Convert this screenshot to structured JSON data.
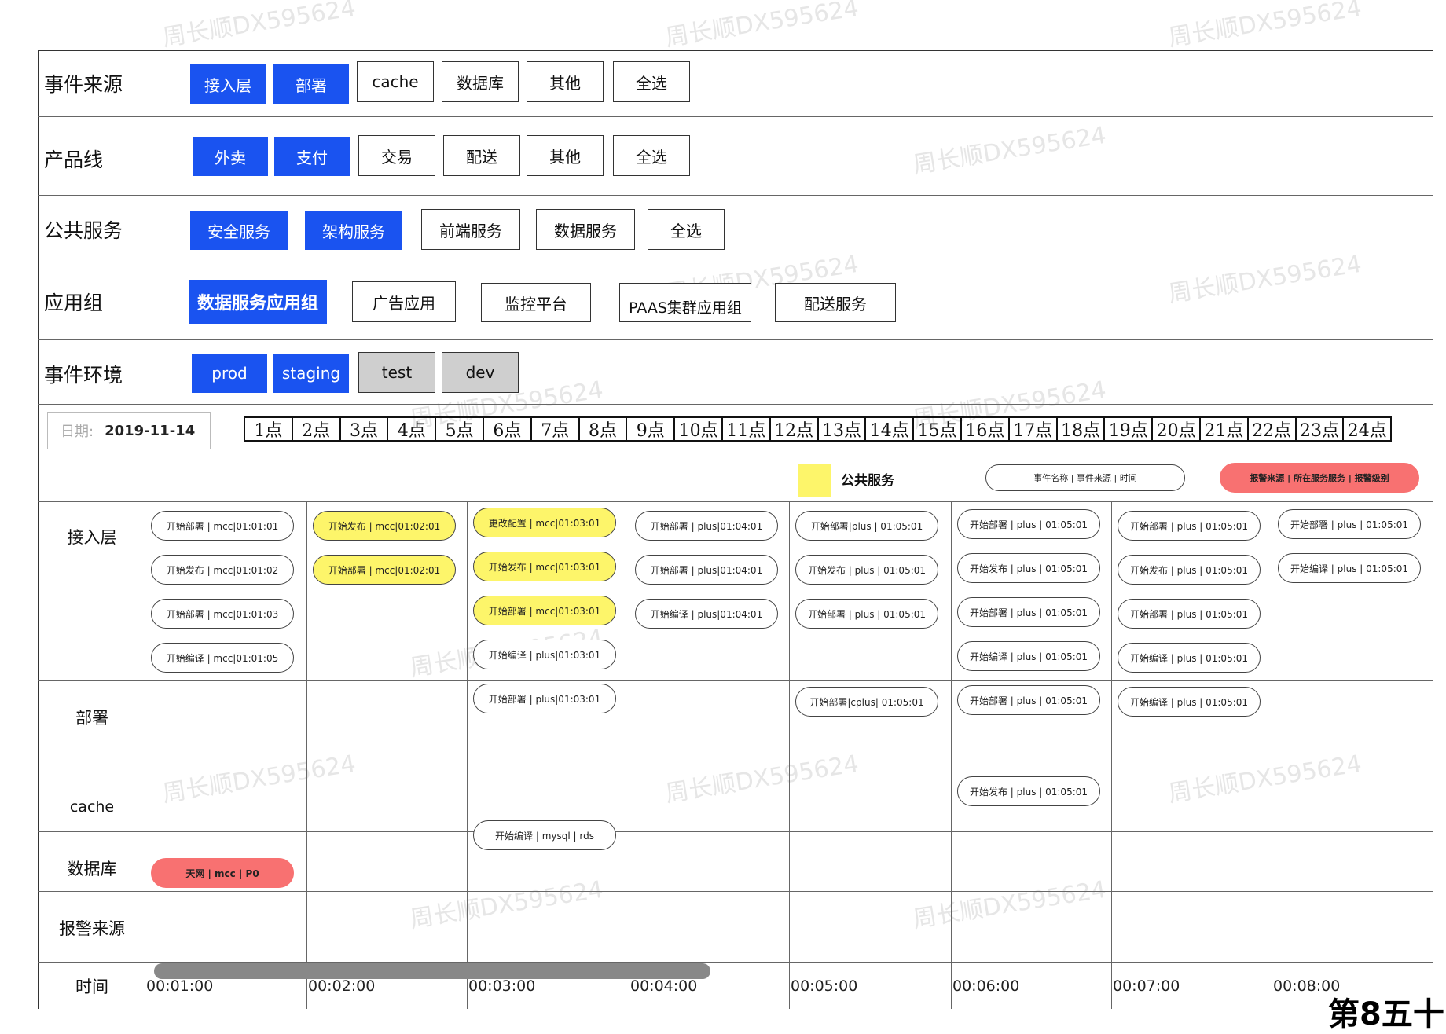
{
  "filters": {
    "event_source": {
      "label": "事件来源",
      "options": [
        "接入层",
        "部署",
        "cache",
        "数据库",
        "其他",
        "全选"
      ],
      "selected": [
        0,
        1
      ]
    },
    "product_line": {
      "label": "产品线",
      "options": [
        "外卖",
        "支付",
        "交易",
        "配送",
        "其他",
        "全选"
      ],
      "selected": [
        0,
        1
      ]
    },
    "public_service": {
      "label": "公共服务",
      "options": [
        "安全服务",
        "架构服务",
        "前端服务",
        "数据服务",
        "全选"
      ],
      "selected": [
        0,
        1
      ]
    },
    "app_group": {
      "label": "应用组",
      "options": [
        "数据服务应用组",
        "广告应用",
        "监控平台",
        "PAAS集群应用组",
        "配送服务"
      ],
      "selected": [
        0
      ]
    },
    "environment": {
      "label": "事件环境",
      "options": [
        "prod",
        "staging",
        "test",
        "dev"
      ],
      "selected": [
        0,
        1
      ],
      "gray": [
        2,
        3
      ]
    }
  },
  "date": {
    "label": "日期:",
    "value": "2019-11-14"
  },
  "hours": [
    "1点",
    "2点",
    "3点",
    "4点",
    "5点",
    "6点",
    "7点",
    "8点",
    "9点",
    "10点",
    "11点",
    "12点",
    "13点",
    "14点",
    "15点",
    "16点",
    "17点",
    "18点",
    "19点",
    "20点",
    "21点",
    "22点",
    "23点",
    "24点"
  ],
  "legend": {
    "public_service": "公共服务",
    "event_format": "事件名称 | 事件来源 | 时间",
    "alarm_format": "报警来源 | 所在服务服务 | 报警级别",
    "public_service_color": "#fdf56a",
    "alarm_color": "#f87171"
  },
  "grid": {
    "rows": [
      "接入层",
      "部署",
      "cache",
      "数据库",
      "报警来源",
      "时间"
    ],
    "times": [
      "00:01:00",
      "00:02:00",
      "00:03:00",
      "00:04:00",
      "00:05:00",
      "00:06:00",
      "00:07:00",
      "00:08:00"
    ],
    "events": [
      [
        "开始部署 | mcc|01:01:01",
        "开始发布 | mcc|01:01:02",
        "开始部署 | mcc|01:01:03",
        "开始编译 | mcc|01:01:05"
      ],
      [
        "开始发布 | mcc|01:02:01",
        "开始部署 | mcc|01:02:01"
      ],
      [
        "更改配置 | mcc|01:03:01",
        "开始发布 | mcc|01:03:01",
        "开始部署 | mcc|01:03:01",
        "开始编译 | plus|01:03:01",
        "开始部署 | plus|01:03:01",
        "开始编译 | mysql | rds"
      ],
      [
        "开始部署 | plus|01:04:01",
        "开始部署 | plus|01:04:01",
        "开始编译 | plus|01:04:01"
      ],
      [
        "开始部署|plus | 01:05:01",
        "开始发布 | plus | 01:05:01",
        "开始部署 | plus | 01:05:01",
        "开始部署|cplus| 01:05:01"
      ],
      [
        "开始部署 | plus | 01:05:01",
        "开始发布 | plus | 01:05:01",
        "开始部署 | plus | 01:05:01",
        "开始编译 | plus | 01:05:01",
        "开始部署 | plus | 01:05:01",
        "开始发布 | plus | 01:05:01"
      ],
      [
        "开始部署 | plus | 01:05:01",
        "开始发布 | plus | 01:05:01",
        "开始部署 | plus | 01:05:01",
        "开始编译 | plus | 01:05:01",
        "开始编译 | plus | 01:05:01"
      ],
      [
        "开始部署 | plus | 01:05:01",
        "开始编译 | plus | 01:05:01"
      ]
    ],
    "alarm": "天网 | mcc | P0"
  },
  "watermark": "周长顺DX595624",
  "cut_text": "第8五十"
}
